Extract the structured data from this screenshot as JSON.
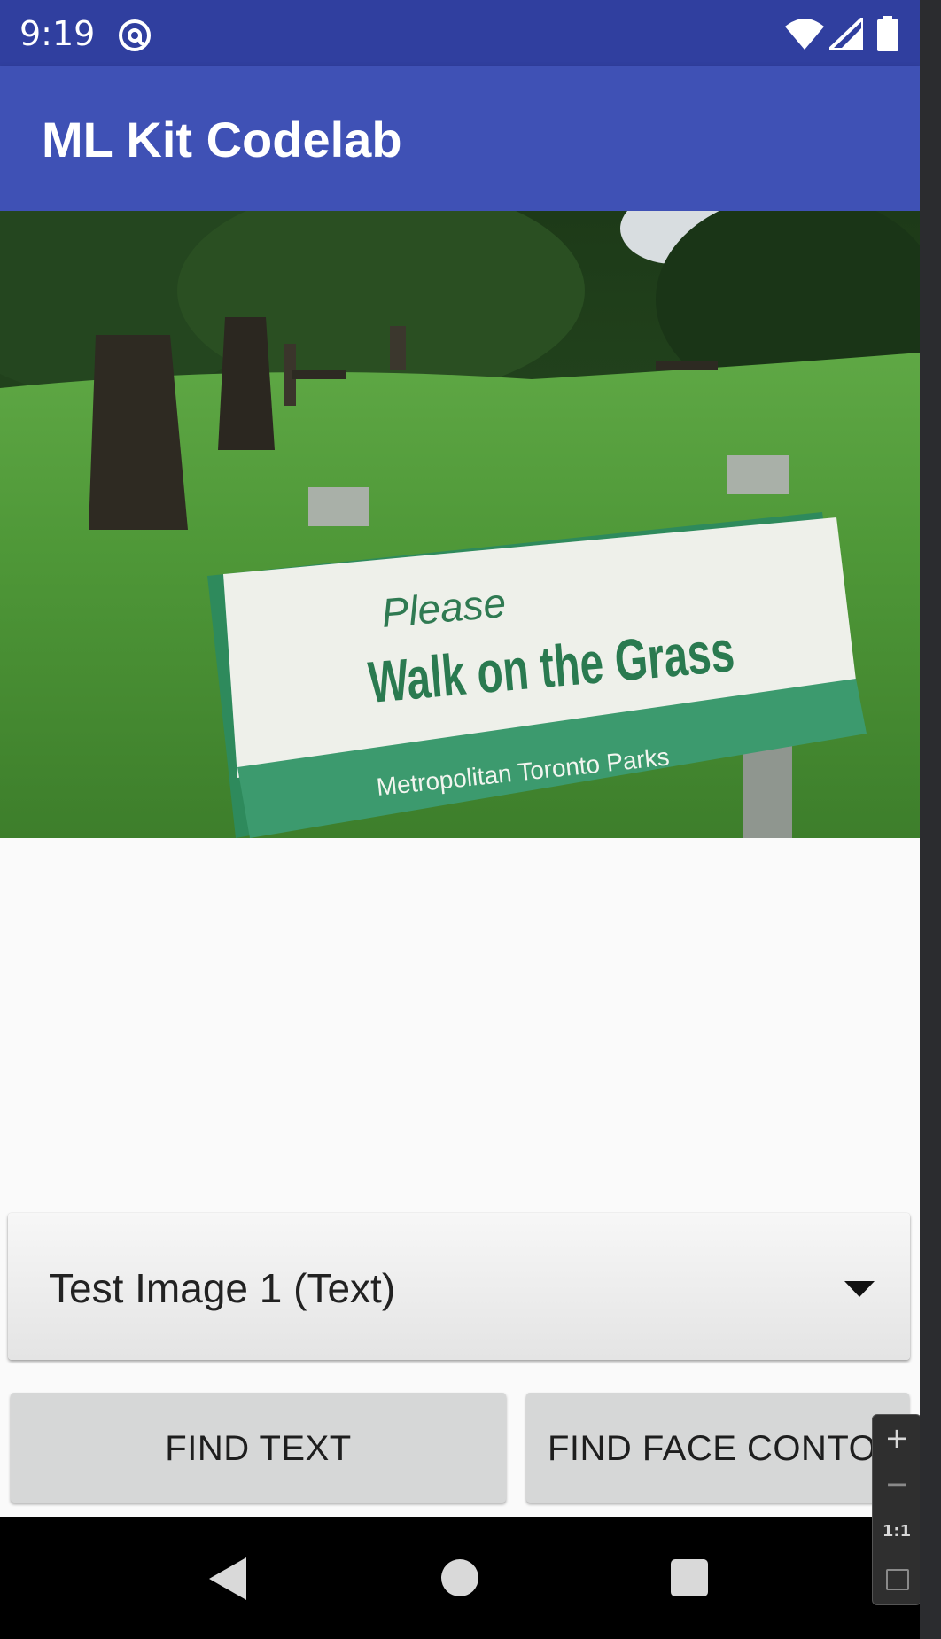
{
  "status_bar": {
    "time": "9:19",
    "icons": [
      "at-sign-notification-icon",
      "wifi-icon",
      "cell-signal-icon",
      "battery-icon"
    ]
  },
  "app_bar": {
    "title": "ML Kit Codelab"
  },
  "image": {
    "sign_line1": "Please",
    "sign_line2": "Walk on the Grass",
    "sign_line3": "Metropolitan Toronto Parks"
  },
  "spinner": {
    "selected": "Test Image 1 (Text)",
    "icon": "dropdown-triangle-icon"
  },
  "buttons": {
    "find_text": "FIND TEXT",
    "find_face_contour": "FIND FACE CONTOUR"
  },
  "nav": {
    "icons": [
      "back-icon",
      "home-icon",
      "recents-icon"
    ]
  },
  "zoom": {
    "zoom_in": "+",
    "zoom_out": "−",
    "reset": "1:1"
  },
  "colors": {
    "status_bar": "#303f9f",
    "app_bar": "#3f51b5",
    "background": "#fafafa",
    "button": "#d6d7d7"
  }
}
